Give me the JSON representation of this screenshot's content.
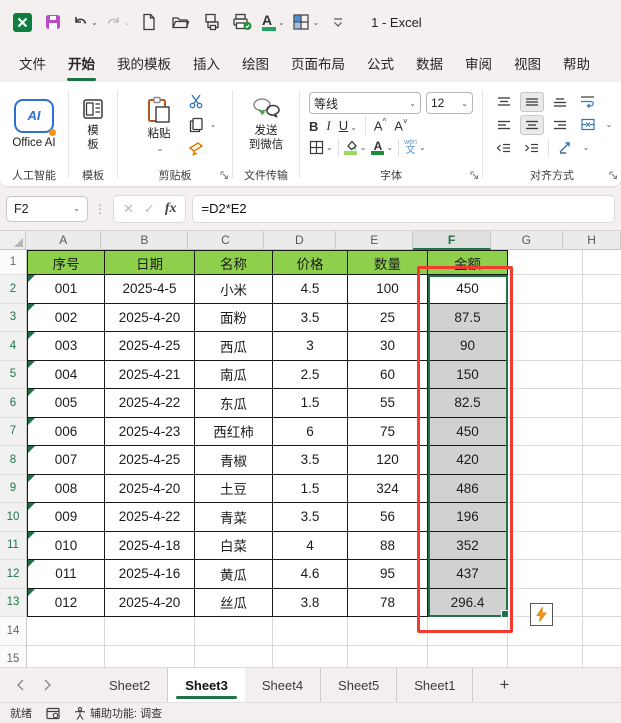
{
  "titlebar": {
    "title": "1  -  Excel"
  },
  "menu": {
    "items": [
      {
        "label": "文件",
        "active": false
      },
      {
        "label": "开始",
        "active": true
      },
      {
        "label": "我的模板",
        "active": false
      },
      {
        "label": "插入",
        "active": false
      },
      {
        "label": "绘图",
        "active": false
      },
      {
        "label": "页面布局",
        "active": false
      },
      {
        "label": "公式",
        "active": false
      },
      {
        "label": "数据",
        "active": false
      },
      {
        "label": "审阅",
        "active": false
      },
      {
        "label": "视图",
        "active": false
      },
      {
        "label": "帮助",
        "active": false
      }
    ]
  },
  "ribbon": {
    "office_ai_label": "Office AI",
    "office_ai_badge": "AI",
    "template_label": "模板",
    "paste_label": "粘贴",
    "wechat_label": "发送\n到微信",
    "font": {
      "name": "等线",
      "size": "12",
      "bold": "B",
      "italic": "I",
      "underline": "U",
      "grow": "A",
      "shrink": "A",
      "phonetic_top": "wén",
      "phonetic_bottom": "文"
    },
    "group_labels": {
      "ai": "人工智能",
      "template": "模板",
      "clipboard": "剪贴板",
      "file_transfer": "文件传输",
      "font": "字体",
      "alignment": "对齐方式"
    },
    "title_font_color_letter": "A"
  },
  "formula_bar": {
    "name_box": "F2",
    "fx": "fx",
    "formula": "=D2*E2"
  },
  "sheet": {
    "columns": [
      "A",
      "B",
      "C",
      "D",
      "E",
      "F",
      "G",
      "H"
    ],
    "selected_column": "F",
    "row_numbers": [
      1,
      2,
      3,
      4,
      5,
      6,
      7,
      8,
      9,
      10,
      11,
      12,
      13,
      14,
      15
    ],
    "header_row": [
      "序号",
      "日期",
      "名称",
      "价格",
      "数量",
      "金额"
    ],
    "rows": [
      [
        "001",
        "2025-4-5",
        "小米",
        "4.5",
        "100",
        "450"
      ],
      [
        "002",
        "2025-4-20",
        "面粉",
        "3.5",
        "25",
        "87.5"
      ],
      [
        "003",
        "2025-4-25",
        "西瓜",
        "3",
        "30",
        "90"
      ],
      [
        "004",
        "2025-4-21",
        "南瓜",
        "2.5",
        "60",
        "150"
      ],
      [
        "005",
        "2025-4-22",
        "东瓜",
        "1.5",
        "55",
        "82.5"
      ],
      [
        "006",
        "2025-4-23",
        "西红柿",
        "6",
        "75",
        "450"
      ],
      [
        "007",
        "2025-4-25",
        "青椒",
        "3.5",
        "120",
        "420"
      ],
      [
        "008",
        "2025-4-20",
        "土豆",
        "1.5",
        "324",
        "486"
      ],
      [
        "009",
        "2025-4-22",
        "青菜",
        "3.5",
        "56",
        "196"
      ],
      [
        "010",
        "2025-4-18",
        "白菜",
        "4",
        "88",
        "352"
      ],
      [
        "011",
        "2025-4-16",
        "黄瓜",
        "4.6",
        "95",
        "437"
      ],
      [
        "012",
        "2025-4-20",
        "丝瓜",
        "3.8",
        "78",
        "296.4"
      ]
    ],
    "active_cell": "F2",
    "selection_range": "F2:F13"
  },
  "sheet_tabs": {
    "tabs": [
      {
        "label": "Sheet2",
        "active": false
      },
      {
        "label": "Sheet3",
        "active": true
      },
      {
        "label": "Sheet4",
        "active": false
      },
      {
        "label": "Sheet5",
        "active": false
      },
      {
        "label": "Sheet1",
        "active": false
      }
    ],
    "add_label": "+"
  },
  "status_bar": {
    "ready": "就绪",
    "accessibility": "辅助功能: 调查"
  },
  "colors": {
    "accent_green": "#217346",
    "table_header_fill": "#8ED04C",
    "selection_fill": "#D1D1D1",
    "annotation_red": "#F23B2E",
    "save_icon": "#BC4BCB",
    "ai_blue": "#2E6FD8"
  }
}
